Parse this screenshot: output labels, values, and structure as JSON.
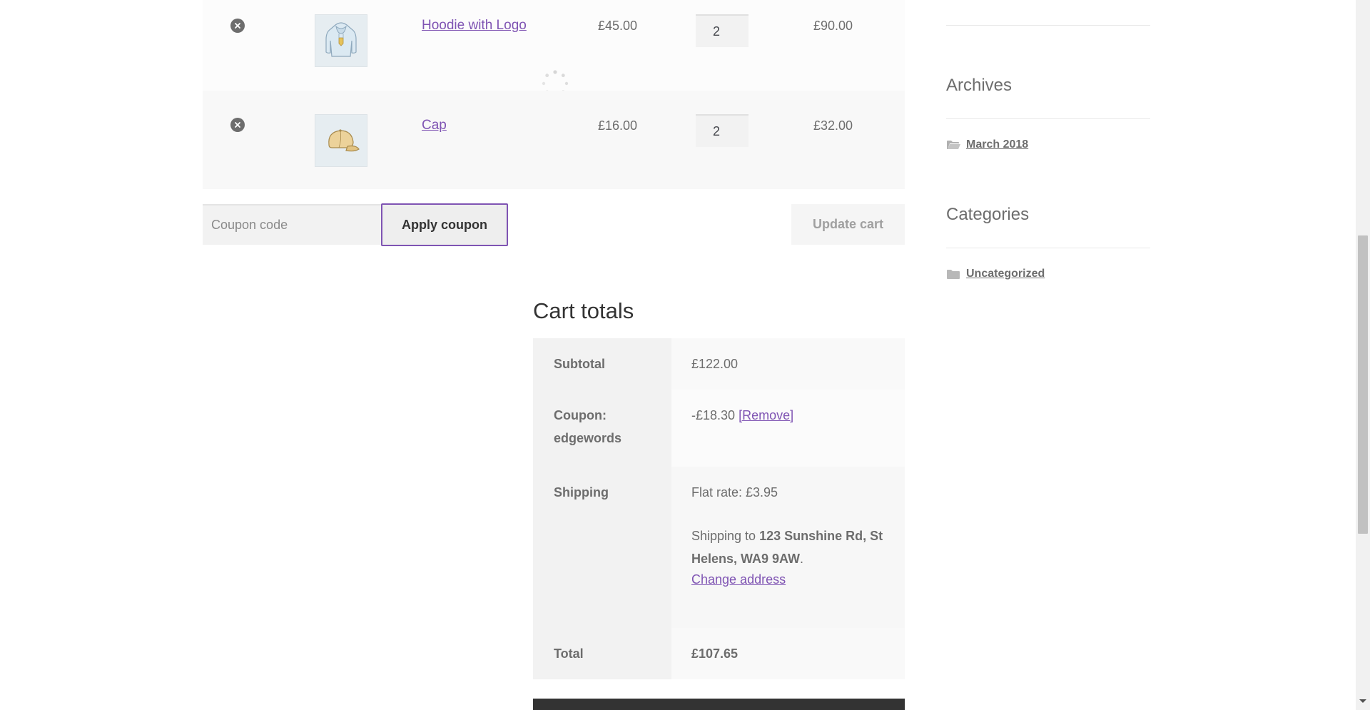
{
  "cart": {
    "items": [
      {
        "name": "Hoodie with Logo",
        "price": "£45.00",
        "qty": "2",
        "subtotal": "£90.00",
        "thumb": "hoodie-thumbnail"
      },
      {
        "name": "Cap",
        "price": "£16.00",
        "qty": "2",
        "subtotal": "£32.00",
        "thumb": "cap-thumbnail"
      }
    ],
    "coupon_placeholder": "Coupon code",
    "apply_label": "Apply coupon",
    "update_label": "Update cart"
  },
  "totals": {
    "title": "Cart totals",
    "subtotal_label": "Subtotal",
    "subtotal_value": "£122.00",
    "coupon_label": "Coupon: edgewords",
    "coupon_value": "-£18.30",
    "coupon_remove": "[Remove]",
    "shipping_label": "Shipping",
    "shipping_rate": "Flat rate: £3.95",
    "shipping_to_prefix": "Shipping to",
    "shipping_address": "123 Sunshine Rd, St Helens, WA9 9AW",
    "shipping_to_suffix": ".",
    "change_address": "Change address",
    "total_label": "Total",
    "total_value": "£107.65"
  },
  "sidebar": {
    "archives_title": "Archives",
    "archives_items": [
      "March 2018"
    ],
    "categories_title": "Categories",
    "categories_items": [
      "Uncategorized"
    ]
  },
  "colors": {
    "accent": "#7f54b3",
    "text": "#6d6d6d",
    "heading": "#333333"
  },
  "icons": {
    "remove": "remove-item-icon",
    "folder": "folder-icon",
    "loading": "loading-spinner-icon"
  }
}
